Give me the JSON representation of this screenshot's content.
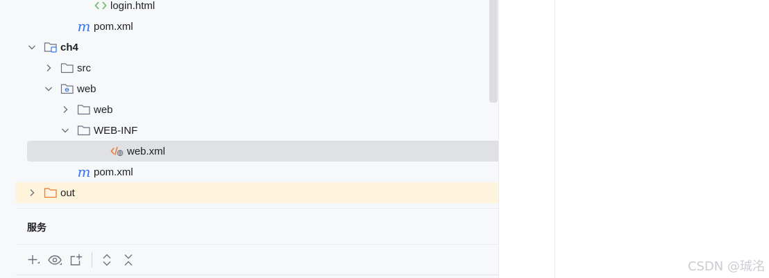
{
  "project_tree": {
    "items": [
      {
        "label": "login.html",
        "indent": 112,
        "arrow": "none",
        "icon": "html-file-icon",
        "bold": false,
        "state": "normal"
      },
      {
        "label": "pom.xml",
        "indent": 88,
        "arrow": "none",
        "icon": "maven-file-icon",
        "bold": false,
        "state": "normal"
      },
      {
        "label": "ch4",
        "indent": 40,
        "arrow": "expanded",
        "icon": "module-folder-icon",
        "bold": true,
        "state": "normal"
      },
      {
        "label": "src",
        "indent": 64,
        "arrow": "collapsed",
        "icon": "folder-icon",
        "bold": false,
        "state": "normal"
      },
      {
        "label": "web",
        "indent": 64,
        "arrow": "expanded",
        "icon": "web-folder-icon",
        "bold": false,
        "state": "normal"
      },
      {
        "label": "web",
        "indent": 88,
        "arrow": "collapsed",
        "icon": "folder-icon",
        "bold": false,
        "state": "normal"
      },
      {
        "label": "WEB-INF",
        "indent": 88,
        "arrow": "expanded",
        "icon": "folder-icon",
        "bold": false,
        "state": "normal"
      },
      {
        "label": "web.xml",
        "indent": 136,
        "arrow": "none",
        "icon": "web-xml-file-icon",
        "bold": false,
        "state": "selected"
      },
      {
        "label": "pom.xml",
        "indent": 88,
        "arrow": "none",
        "icon": "maven-file-icon",
        "bold": false,
        "state": "normal"
      },
      {
        "label": "out",
        "indent": 40,
        "arrow": "collapsed",
        "icon": "excluded-folder-icon",
        "bold": false,
        "state": "highlight"
      }
    ]
  },
  "services": {
    "title": "服务",
    "toolbar": [
      {
        "name": "add-service-button",
        "icon": "plus-icon"
      },
      {
        "name": "view-options-button",
        "icon": "eye-icon"
      },
      {
        "name": "new-group-button",
        "icon": "add-group-icon"
      },
      {
        "name": "expand-all-button",
        "icon": "expand-all-icon"
      },
      {
        "name": "collapse-all-button",
        "icon": "collapse-all-icon"
      }
    ]
  },
  "watermark": "CSDN @珹洺"
}
